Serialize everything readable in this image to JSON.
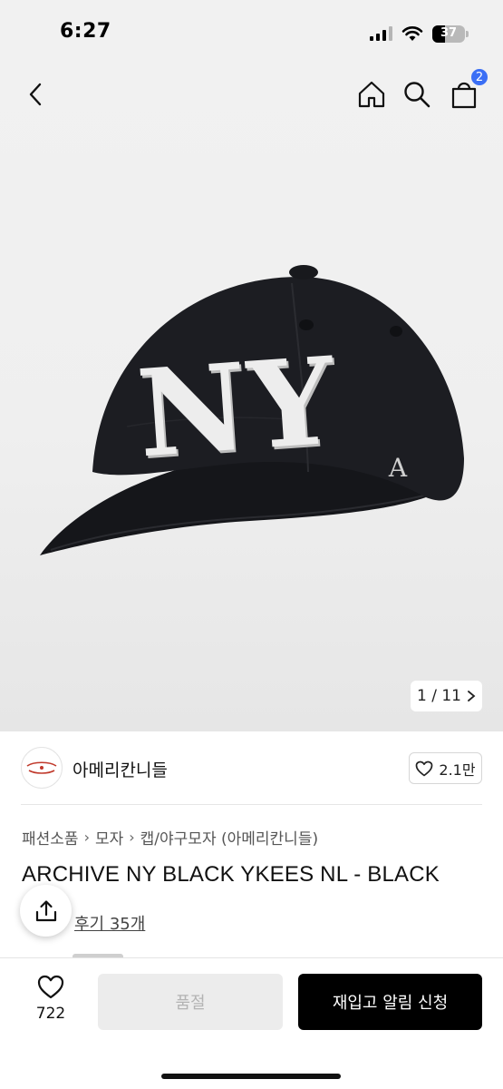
{
  "status_bar": {
    "time": "6:27",
    "battery": "37"
  },
  "header": {
    "cart_badge": "2"
  },
  "gallery": {
    "counter": "1 / 11",
    "logo_text": "NY"
  },
  "brand": {
    "name": "아메리칸니들",
    "likes": "2.1만"
  },
  "breadcrumb": [
    "패션소품",
    "모자",
    "캡/야구모자 (아메리칸니들)"
  ],
  "product": {
    "title": "ARCHIVE NY BLACK YKEES NL - BLACK",
    "review_label": "후기 35개"
  },
  "bottom_bar": {
    "wish_count": "722",
    "soldout_label": "품절",
    "restock_label": "재입고 알림 신청"
  },
  "colors": {
    "badge": "#3b6ff5",
    "cap": "#1c1d22",
    "primary_button": "#000000"
  }
}
